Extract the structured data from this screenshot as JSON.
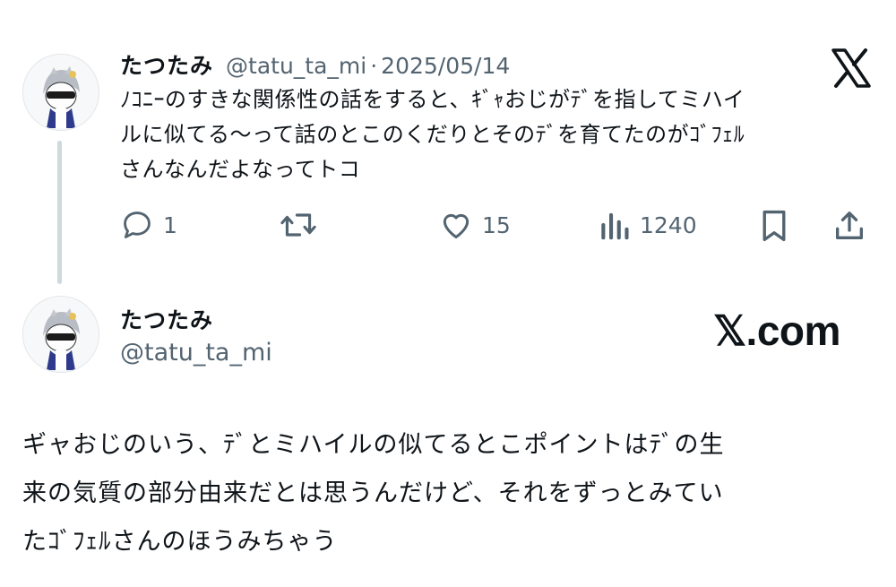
{
  "tweet": {
    "author": "たつたみ",
    "handle": "@tatu_ta_mi",
    "separator": "·",
    "date": "2025/05/14",
    "lines": [
      "ﾉｺﾆｰのすきな関係性の話をすると、ｷﾞｬおじがﾃﾞを指してミハイ",
      "ルに似てる〜って話のとこのくだりとそのﾃﾞを育てたのがｺﾞﾌｪﾙ",
      "さんなんだよなってトコ"
    ],
    "stats": {
      "replies": "1",
      "likes": "15",
      "views": "1240"
    },
    "icons": {
      "reply": "reply-icon",
      "retweet": "retweet-icon",
      "like": "heart-icon",
      "views": "views-icon",
      "bookmark": "bookmark-icon",
      "share": "share-icon",
      "brand": "x-logo-icon"
    }
  },
  "card": {
    "author": "たつたみ",
    "handle": "@tatu_ta_mi",
    "brand": "𝕏.com",
    "lines": [
      "ギャおじのいう、ﾃﾞとミハイルの似てるとこポイントはﾃﾞの生",
      "来の気質の部分由来だとは思うんだけど、それをずっとみてい",
      "たｺﾞﾌｪﾙさんのほうみちゃう"
    ]
  },
  "colors": {
    "text": "#0f1419",
    "secondary": "#536471",
    "thread_line": "#cfd9de"
  }
}
